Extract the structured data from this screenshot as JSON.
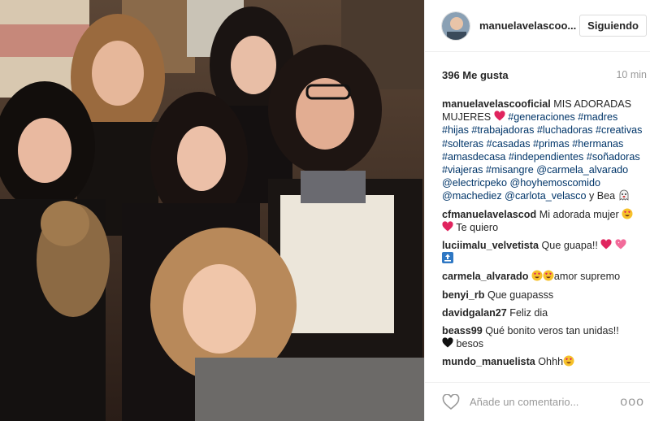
{
  "header": {
    "username": "manuelavelascoo...",
    "follow_label": "Siguiendo"
  },
  "meta": {
    "likes": "396 Me gusta",
    "time": "10 min"
  },
  "caption": {
    "user": "manuelavelascooficial",
    "text": "MIS ADORADAS MUJERES",
    "hashtags": "#generaciones #madres #hijas #trabajadoras #luchadoras #creativas #solteras #casadas #primas #hermanas #amasdecasa #independientes #soñadoras #viajeras #misangre",
    "mentions": "@carmela_alvarado @electricpeko @hoyhemoscomido @machediez @carlota_velasco",
    "tail": "y Bea"
  },
  "comments": [
    {
      "user": "cfmanuelavelascod",
      "text_a": "Mi adorada mujer",
      "text_b": "Te quiero"
    },
    {
      "user": "luciimalu_velvetista",
      "text": "Que guapa!!"
    },
    {
      "user": "carmela_alvarado",
      "text": "amor supremo"
    },
    {
      "user": "benyi_rb",
      "text": "Que guapasss"
    },
    {
      "user": "davidgalan27",
      "text": "Feliz dia"
    },
    {
      "user": "beass99",
      "text_a": "Qué bonito veros tan unidas!!",
      "text_b": "besos"
    },
    {
      "user": "mundo_manuelista",
      "text": "Ohhh"
    }
  ],
  "footer": {
    "comment_placeholder": "Añade un comentario...",
    "more_label": "ooo"
  },
  "icons": {
    "like": "heart-outline-icon",
    "more": "more-options-icon",
    "heart": "red-heart-emoji",
    "heart_eyes": "heart-eyes-emoji",
    "ghost": "ghost-emoji",
    "top": "top-arrow-emoji"
  },
  "colors": {
    "link": "#003569",
    "heart": "#e0245e",
    "text": "#262626",
    "muted": "#999999"
  }
}
